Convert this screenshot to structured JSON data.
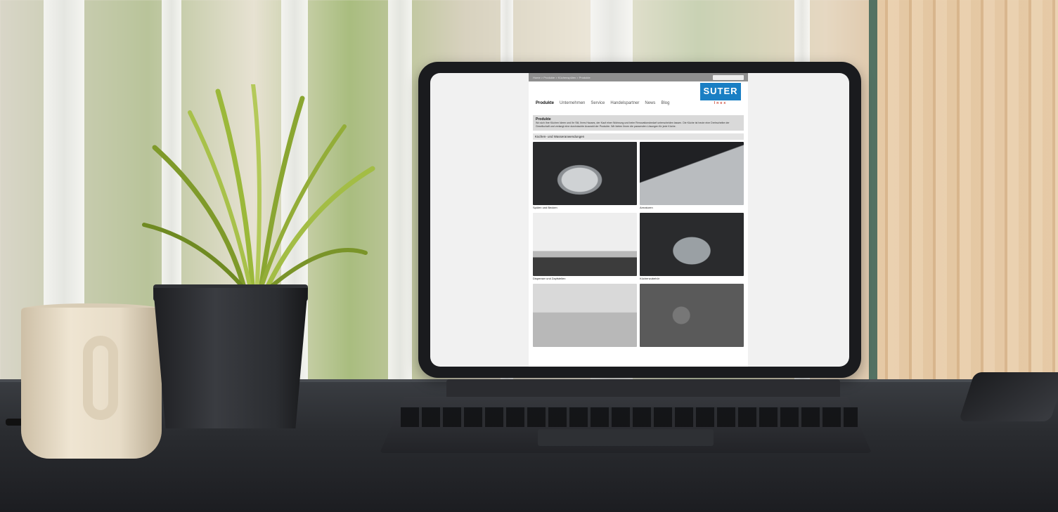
{
  "website": {
    "breadcrumbs": "Home > Produkte > Küchenspülen > Produkte",
    "search_placeholder": "",
    "nav": [
      {
        "label": "Produkte",
        "active": true
      },
      {
        "label": "Unternehmen",
        "active": false
      },
      {
        "label": "Service",
        "active": false
      },
      {
        "label": "Handelspartner",
        "active": false
      },
      {
        "label": "News",
        "active": false
      },
      {
        "label": "Blog",
        "active": false
      }
    ],
    "logo": {
      "name": "SUTER",
      "tagline": "Inox"
    },
    "intro": {
      "heading": "Produkte",
      "text": "Wo sich Ihre Küchen Ideen und Ihr Stil, Ihres Hauses, der Kauf einer Wohnung und beim Renovationsbedarf unterscheiden lassen. Die Küche ist heute eine Drehscheibe der Gesellschaft und verlangt eine durchdachte Auswahl der Produkte. Wir bieten Ihnen die passenden Lösungen für jede Küche."
    },
    "section_title": "Küchen- und Wasseranwendungen",
    "tiles": [
      {
        "caption": "Spülen und Becken",
        "icon": "sink-photo"
      },
      {
        "caption": "Armaturen",
        "icon": "faucet-photo"
      },
      {
        "caption": "Dispenser und Zapfstellen",
        "icon": "tap-photo"
      },
      {
        "caption": "Küchenzubehör",
        "icon": "accessory-photo"
      },
      {
        "caption": "",
        "icon": "countertop-photo"
      },
      {
        "caption": "",
        "icon": "accessory-photo"
      }
    ]
  }
}
